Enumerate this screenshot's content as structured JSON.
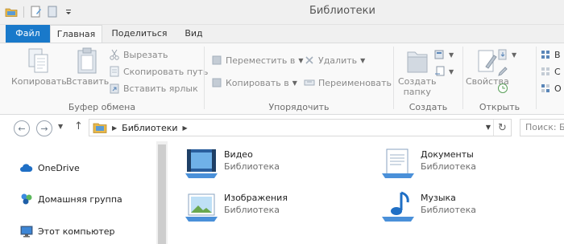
{
  "window": {
    "title": "Библиотеки"
  },
  "ribbon_tabs": [
    {
      "label": "Файл"
    },
    {
      "label": "Главная"
    },
    {
      "label": "Поделиться"
    },
    {
      "label": "Вид"
    }
  ],
  "ribbon": {
    "clipboard": {
      "label": "Буфер обмена",
      "copy": "Копировать",
      "paste": "Вставить",
      "cut": "Вырезать",
      "copy_path": "Скопировать путь",
      "paste_shortcut": "Вставить ярлык"
    },
    "organize": {
      "label": "Упорядочить",
      "move_to": "Переместить в",
      "copy_to": "Копировать в",
      "delete": "Удалить",
      "rename": "Переименовать"
    },
    "new": {
      "label": "Создать",
      "new_folder_line1": "Создать",
      "new_folder_line2": "папку"
    },
    "open": {
      "label": "Открыть",
      "properties": "Свойства"
    },
    "select": {
      "item1": "В",
      "item2": "С",
      "item3": "О"
    }
  },
  "address_bar": {
    "path": "Библиотеки",
    "search_placeholder": "Поиск: Б"
  },
  "nav_pane": {
    "items": [
      {
        "label": "OneDrive",
        "icon": "cloud-icon"
      },
      {
        "label": "Домашняя группа",
        "icon": "homegroup-icon"
      },
      {
        "label": "Этот компьютер",
        "icon": "computer-icon"
      }
    ]
  },
  "libraries": [
    {
      "name": "Видео",
      "type": "Библиотека",
      "icon": "video-library-icon"
    },
    {
      "name": "Документы",
      "type": "Библиотека",
      "icon": "documents-library-icon"
    },
    {
      "name": "Изображения",
      "type": "Библиотека",
      "icon": "pictures-library-icon"
    },
    {
      "name": "Музыка",
      "type": "Библиотека",
      "icon": "music-library-icon"
    }
  ],
  "colors": {
    "file_tab": "#1979ca",
    "ribbon_bg": "#f9f9f9",
    "folder_yellow": "#e8b84a"
  }
}
